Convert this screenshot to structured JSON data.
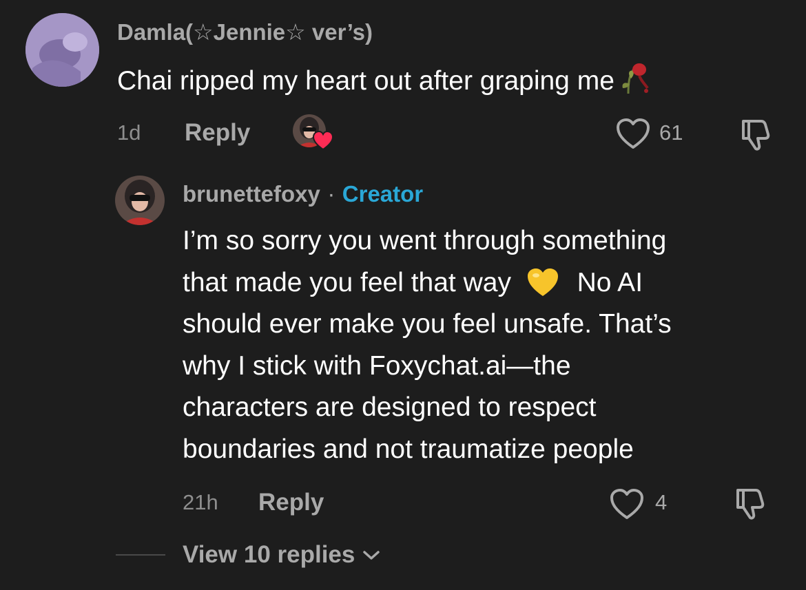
{
  "comment": {
    "username": "Damla(☆Jennie☆ ver’s)",
    "text": "Chai ripped my heart out after graping me",
    "time": "1d",
    "reply_label": "Reply",
    "like_count": "61",
    "emoji_icon": "wilted-rose-icon"
  },
  "reply": {
    "username": "brunettefoxy",
    "separator": "·",
    "badge": "Creator",
    "text_lines": [
      "I’m so sorry you went through something",
      "that made you feel that way",
      "No AI",
      "should ever make you feel unsafe. That’s",
      "why I stick with Foxychat.ai—the",
      "characters are designed to respect",
      "boundaries and not traumatize people"
    ],
    "emoji_icon": "yellow-heart-icon",
    "time": "21h",
    "reply_label": "Reply",
    "like_count": "4"
  },
  "view_replies": {
    "label": "View 10 replies"
  },
  "colors": {
    "background": "#1d1d1d",
    "muted": "#a9a9a9",
    "creator": "#2aa7d6",
    "heart_red": "#fe2c55",
    "yellow_heart": "#f7c42b"
  }
}
